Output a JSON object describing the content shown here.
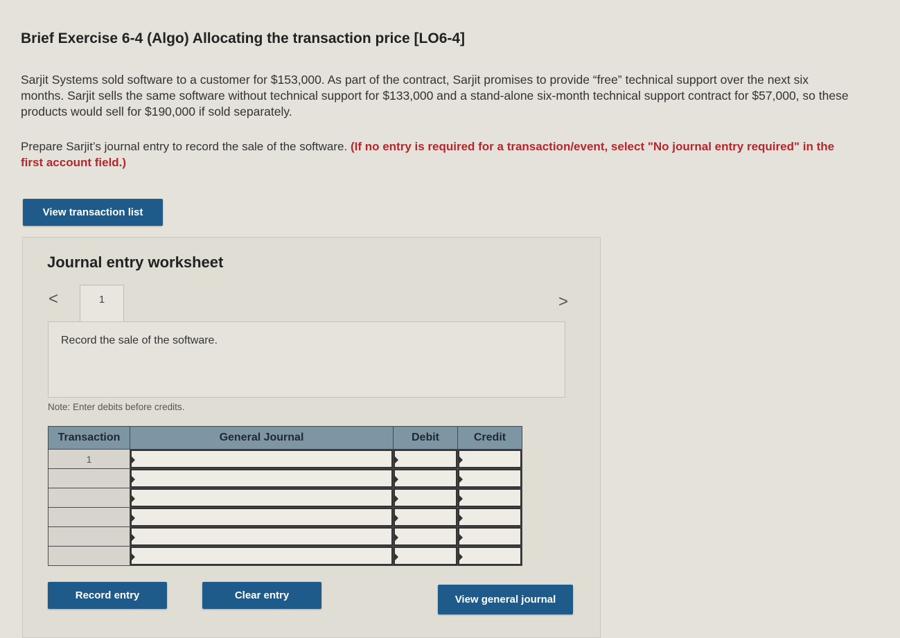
{
  "header": {
    "title": "Brief Exercise 6-4 (Algo) Allocating the transaction price [LO6-4]"
  },
  "problem": {
    "description": "Sarjit Systems sold software to a customer for $153,000. As part of the contract, Sarjit promises to provide “free” technical support over the next six months. Sarjit sells the same software without technical support for $133,000 and a stand-alone six-month technical support contract for $57,000, so these products would sell for $190,000 if sold separately.",
    "instruction": "Prepare Sarjit’s journal entry to record the sale of the software.",
    "instruction_bold": "(If no entry is required for a transaction/event, select \"No journal entry required\" in the first account field.)"
  },
  "buttons": {
    "view_transaction_list": "View transaction list",
    "record_entry": "Record entry",
    "clear_entry": "Clear entry",
    "view_general_journal": "View general journal"
  },
  "worksheet": {
    "title": "Journal entry worksheet",
    "nav_prev": "<",
    "nav_next": ">",
    "tab_label": "1",
    "record_prompt": "Record the sale of the software.",
    "note": "Note: Enter debits before credits."
  },
  "journal_table": {
    "headers": {
      "transaction": "Transaction",
      "general_journal": "General Journal",
      "debit": "Debit",
      "credit": "Credit"
    },
    "rows": [
      {
        "transaction": "1"
      },
      {
        "transaction": ""
      },
      {
        "transaction": ""
      },
      {
        "transaction": ""
      },
      {
        "transaction": ""
      },
      {
        "transaction": ""
      }
    ]
  },
  "colors": {
    "button_blue": "#1f5b8a",
    "header_gray_blue": "#7e95a4",
    "instruction_red": "#b3272d"
  }
}
